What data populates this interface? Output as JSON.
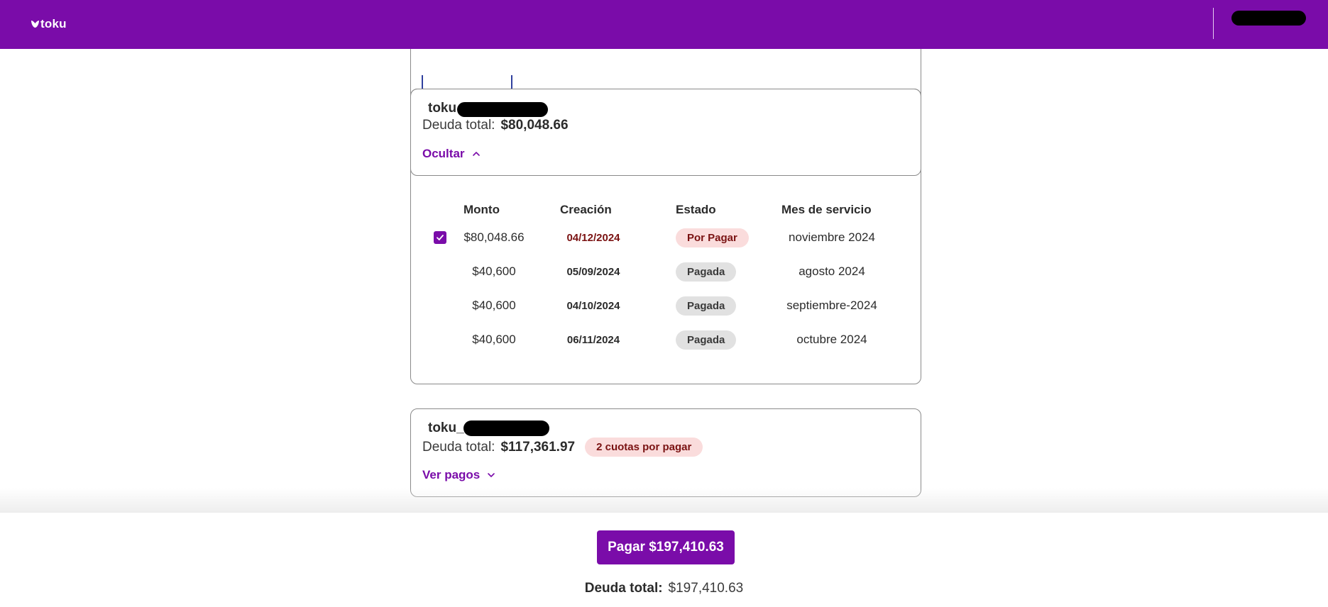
{
  "header": {
    "logo_text": "toku",
    "colors": {
      "brand": "#7a0ca9"
    }
  },
  "accounts": [
    {
      "name_prefix": "toku",
      "debt_label": "Deuda total:",
      "debt_amount": "$80,048.66",
      "toggle_label": "Ocultar",
      "toggle_icon": "chevron-up-icon",
      "table": {
        "columns": [
          "Monto",
          "Creación",
          "Estado",
          "Mes de servicio"
        ],
        "rows": [
          {
            "amount": "$80,048.66",
            "created": "04/12/2024",
            "status": "Por Pagar",
            "month": "noviembre 2024",
            "selected": true
          },
          {
            "amount": "$40,600",
            "created": "05/09/2024",
            "status": "Pagada",
            "month": "agosto 2024",
            "selected": false
          },
          {
            "amount": "$40,600",
            "created": "04/10/2024",
            "status": "Pagada",
            "month": "septiembre-2024",
            "selected": false
          },
          {
            "amount": "$40,600",
            "created": "06/11/2024",
            "status": "Pagada",
            "month": "octubre 2024",
            "selected": false
          }
        ]
      }
    },
    {
      "name_prefix": "toku_",
      "debt_label": "Deuda total:",
      "debt_amount": "$117,361.97",
      "badge": "2 cuotas por pagar",
      "toggle_label": "Ver pagos",
      "toggle_icon": "chevron-down-icon"
    }
  ],
  "footer": {
    "pay_button": "Pagar $197,410.63",
    "total_label": "Deuda total:",
    "total_value": "$197,410.63"
  }
}
